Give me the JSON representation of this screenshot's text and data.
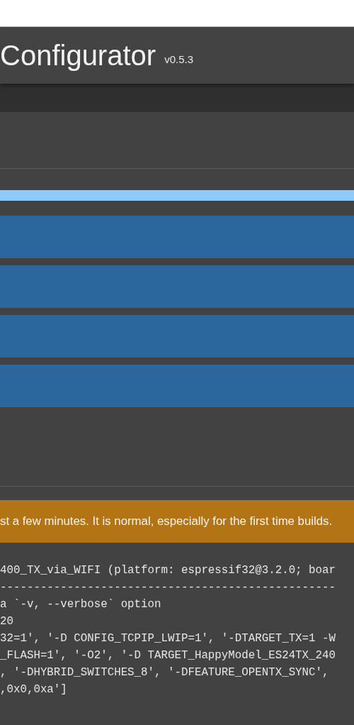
{
  "header": {
    "title": "Configurator",
    "version": "v0.5.3"
  },
  "progress": {
    "level": 1
  },
  "notice": "st a few minutes. It is normal, especially for the first time builds.",
  "log_lines": [
    "400_TX_via_WIFI (platform: espressif32@3.2.0; boar",
    "--------------------------------------------------",
    "a `-v, --verbose` option",
    "20",
    "32=1', '-D CONFIG_TCPIP_LWIP=1', '-DTARGET_TX=1 -W",
    "_FLASH=1', '-O2', '-D TARGET_HappyModel_ES24TX_240",
    ", '-DHYBRID_SWITCHES_8', '-DFEATURE_OPENTX_SYNC',",
    ",0x0,0xa']"
  ]
}
